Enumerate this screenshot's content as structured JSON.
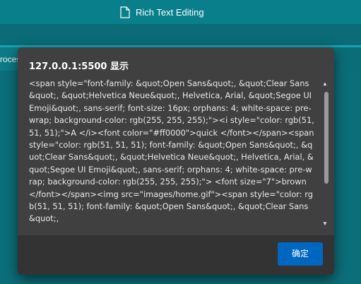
{
  "app": {
    "document_title": "Rich Text Editing",
    "left_tab_partial": "roces"
  },
  "dialog": {
    "title": "127.0.0.1:5500 显示",
    "message": "<span style=\"font-family: &quot;Open Sans&quot;, &quot;Clear Sans&quot;, &quot;Helvetica Neue&quot;, Helvetica, Arial, &quot;Segoe UI Emoji&quot;, sans-serif; font-size: 16px; orphans: 4; white-space: pre-wrap; background-color: rgb(255, 255, 255);\"><i style=\"color: rgb(51, 51, 51);\">A </i><font color=\"#ff0000\">quick </font></span><span style=\"color: rgb(51, 51, 51); font-family: &quot;Open Sans&quot;, &quot;Clear Sans&quot;, &quot;Helvetica Neue&quot;, Helvetica, Arial, &quot;Segoe UI Emoji&quot;, sans-serif; orphans: 4; white-space: pre-wrap; background-color: rgb(255, 255, 255);\"> <font size=\"7\">brown</font></span><img src=\"images/home.gif\"><span style=\"color: rgb(51, 51, 51); font-family: &quot;Open Sans&quot;, &quot;Clear Sans&quot;,",
    "ok_label": "确定",
    "scroll_up_glyph": "▲",
    "scroll_down_glyph": "▼"
  },
  "colors": {
    "teal_header": "#0a7f8c",
    "dialog_bg": "#404040",
    "footer_bg": "#333333",
    "ok_button_bg": "#0067c0"
  },
  "icons": {
    "document": "document-icon"
  }
}
